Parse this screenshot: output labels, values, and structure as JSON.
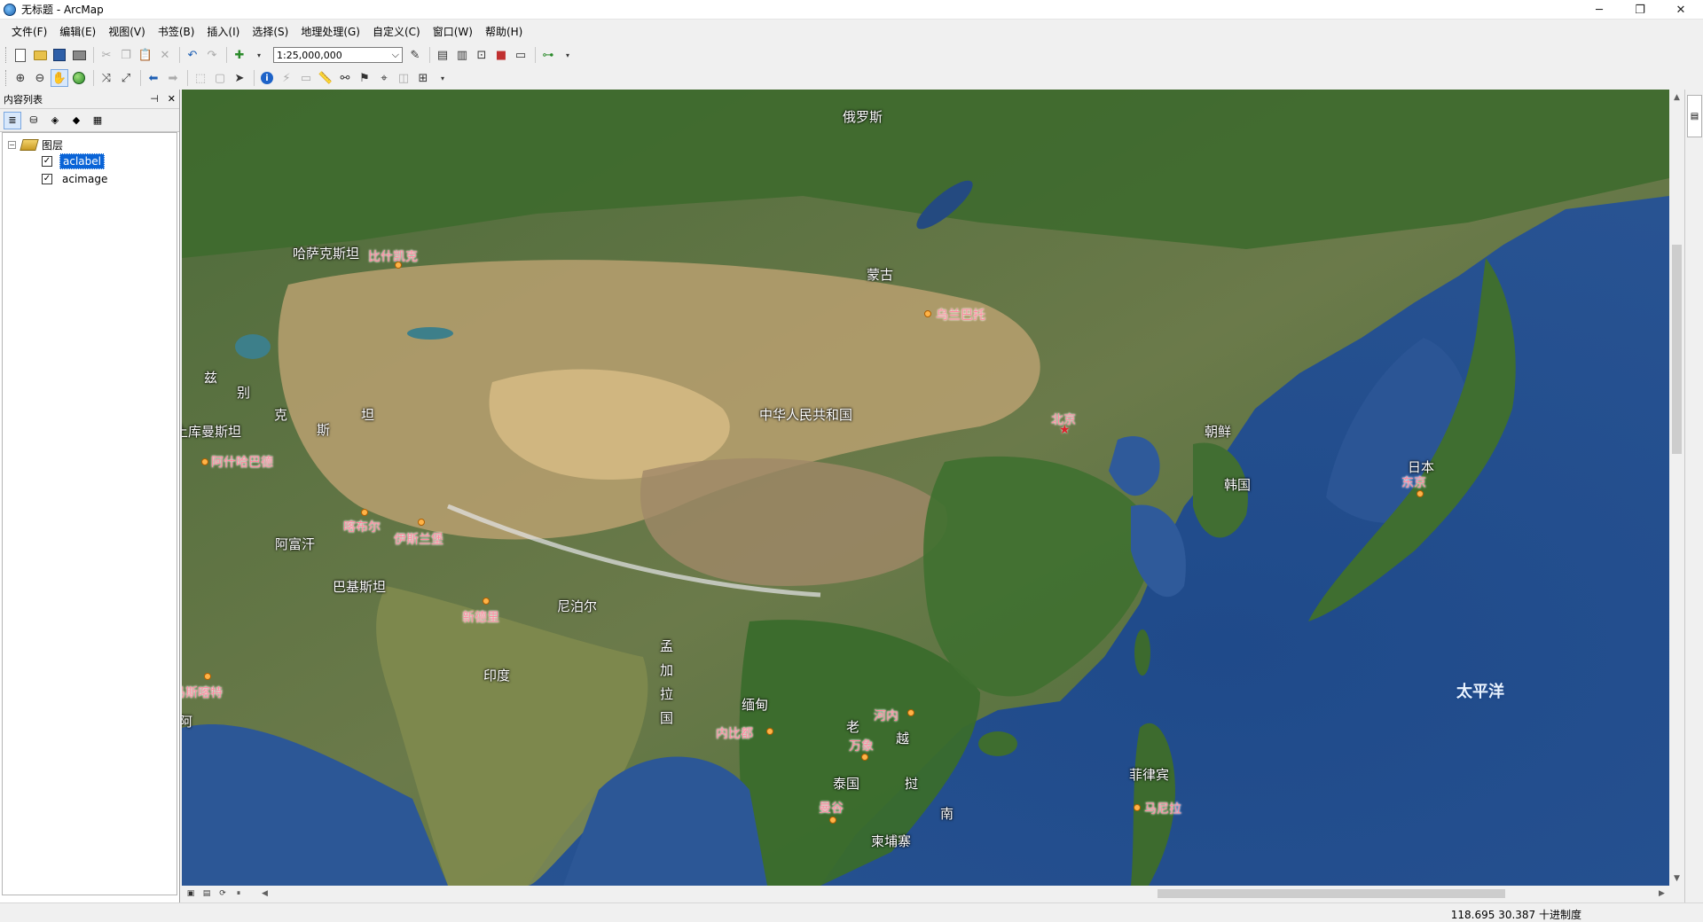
{
  "window": {
    "title": "无标题 - ArcMap",
    "minimize": "─",
    "maximize": "❐",
    "close": "✕"
  },
  "menu": [
    "文件(F)",
    "编辑(E)",
    "视图(V)",
    "书签(B)",
    "插入(I)",
    "选择(S)",
    "地理处理(G)",
    "自定义(C)",
    "窗口(W)",
    "帮助(H)"
  ],
  "toolbar": {
    "scale_value": "1:25,000,000",
    "scale_dropdown_arrow": "⌵"
  },
  "toc": {
    "title": "内容列表",
    "pin": "⊣",
    "close": "✕",
    "root_expander": "−",
    "root_label": "图层",
    "layers": [
      {
        "name": "aclabel",
        "checked": "✓",
        "selected": true
      },
      {
        "name": "acimage",
        "checked": "✓",
        "selected": false
      }
    ]
  },
  "map": {
    "labels": [
      {
        "text": "俄罗斯",
        "kind": "country"
      },
      {
        "text": "哈萨克斯坦",
        "kind": "country"
      },
      {
        "text": "蒙古",
        "kind": "country"
      },
      {
        "text": "中华人民共和国",
        "kind": "country"
      },
      {
        "text": "朝鲜",
        "kind": "country"
      },
      {
        "text": "韩国",
        "kind": "country"
      },
      {
        "text": "日本",
        "kind": "country"
      },
      {
        "text": "阿富汗",
        "kind": "country"
      },
      {
        "text": "巴基斯坦",
        "kind": "country"
      },
      {
        "text": "尼泊尔",
        "kind": "country"
      },
      {
        "text": "印度",
        "kind": "country"
      },
      {
        "text": "缅甸",
        "kind": "country"
      },
      {
        "text": "泰国",
        "kind": "country"
      },
      {
        "text": "柬埔寨",
        "kind": "country"
      },
      {
        "text": "菲律宾",
        "kind": "country"
      },
      {
        "text": "土库曼斯坦",
        "kind": "country"
      },
      {
        "text": "太平洋",
        "kind": "ocean"
      },
      {
        "text": "乌兰巴托",
        "kind": "city"
      },
      {
        "text": "比什凯克",
        "kind": "city"
      },
      {
        "text": "阿什哈巴德",
        "kind": "city"
      },
      {
        "text": "喀布尔",
        "kind": "city"
      },
      {
        "text": "伊斯兰堡",
        "kind": "city"
      },
      {
        "text": "新德里",
        "kind": "city"
      },
      {
        "text": "马斯喀特",
        "kind": "city"
      },
      {
        "text": "内比都",
        "kind": "city"
      },
      {
        "text": "河内",
        "kind": "city"
      },
      {
        "text": "万象",
        "kind": "city"
      },
      {
        "text": "曼谷",
        "kind": "city"
      },
      {
        "text": "马尼拉",
        "kind": "city"
      },
      {
        "text": "东京",
        "kind": "city"
      },
      {
        "text": "北京",
        "kind": "capital"
      }
    ],
    "vertical_labels": [
      {
        "text": "孟加拉国"
      },
      {
        "text": "老"
      },
      {
        "text": "越"
      },
      {
        "text": "挝"
      },
      {
        "text": "南"
      },
      {
        "text": "兹"
      },
      {
        "text": "别"
      },
      {
        "text": "克"
      },
      {
        "text": "斯"
      },
      {
        "text": "坦"
      },
      {
        "text": "阿"
      }
    ],
    "capital_symbol": "★"
  },
  "status": {
    "coordinates": "118.695  30.387 十进制度"
  },
  "colors": {
    "selection": "#0a64d7",
    "city_label": "#ff8aa0",
    "capital": "#e0202c",
    "ocean": "#2a4f86"
  }
}
